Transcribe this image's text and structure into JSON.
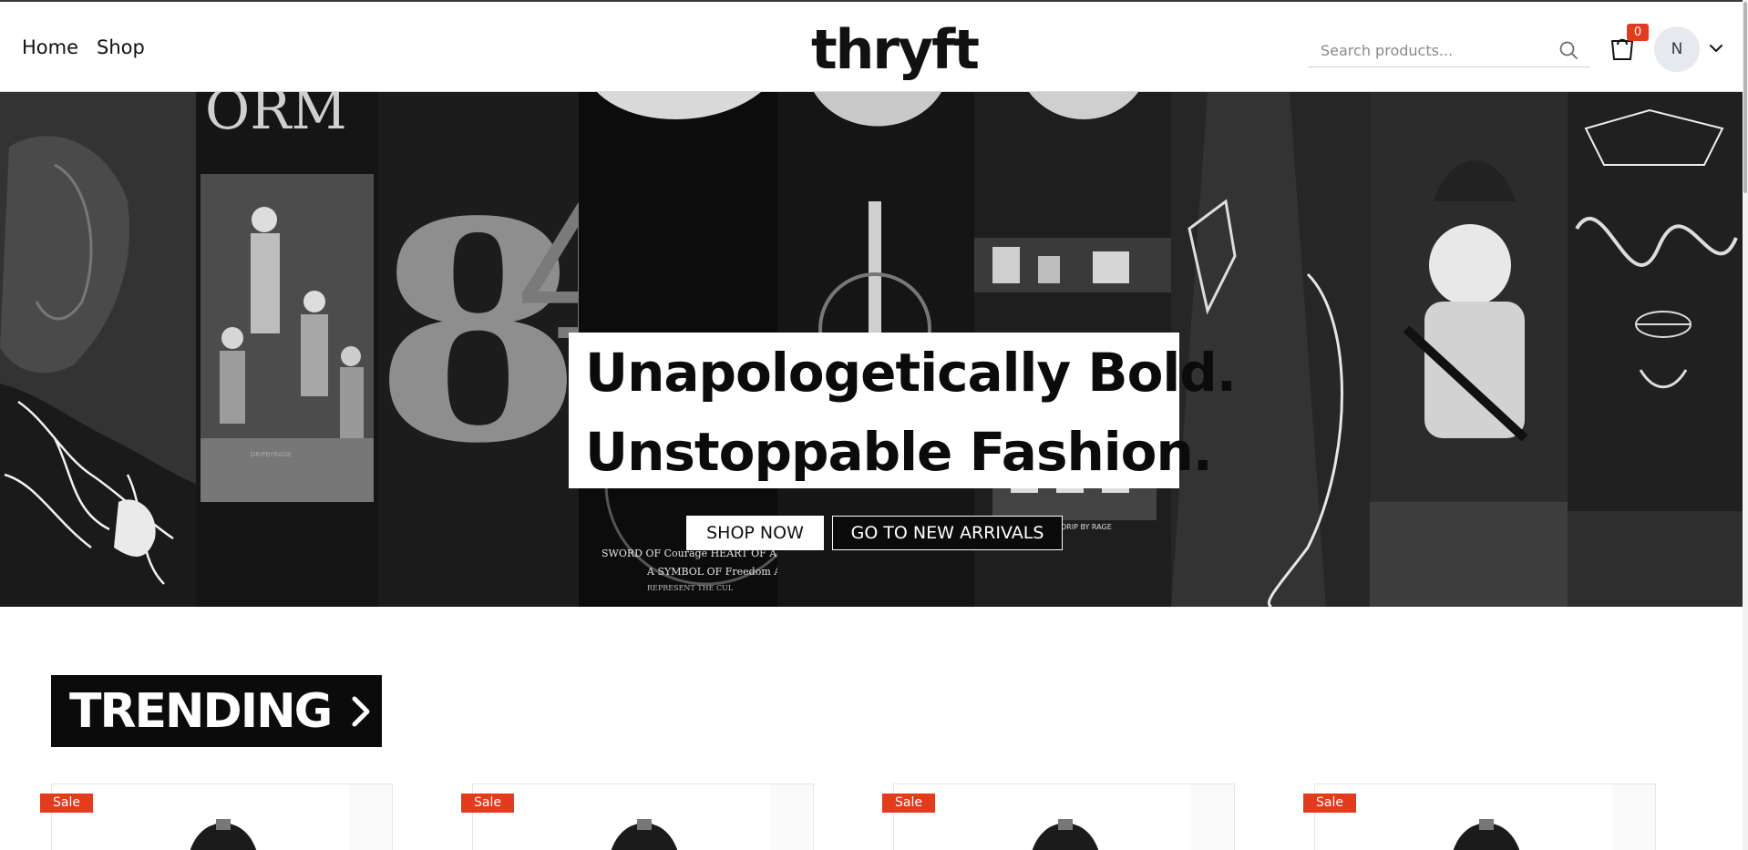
{
  "nav": {
    "links": [
      "Home",
      "Shop"
    ],
    "logo": "thryft"
  },
  "search": {
    "placeholder": "Search products..."
  },
  "cart": {
    "count": "0"
  },
  "user": {
    "initial": "N"
  },
  "hero": {
    "headline_line1": "Unapologetically Bold.",
    "headline_line2": "Unstoppable Fashion.",
    "primary_button": "SHOP NOW",
    "secondary_button": "GO TO NEW ARRIVALS"
  },
  "trending": {
    "label": "TRENDING"
  },
  "products": [
    {
      "badge": "Sale"
    },
    {
      "badge": "Sale"
    },
    {
      "badge": "Sale"
    },
    {
      "badge": "Sale"
    }
  ],
  "colors": {
    "accent": "#e23b1e",
    "hero_bg": "#0f0f0f",
    "text": "#111111"
  }
}
